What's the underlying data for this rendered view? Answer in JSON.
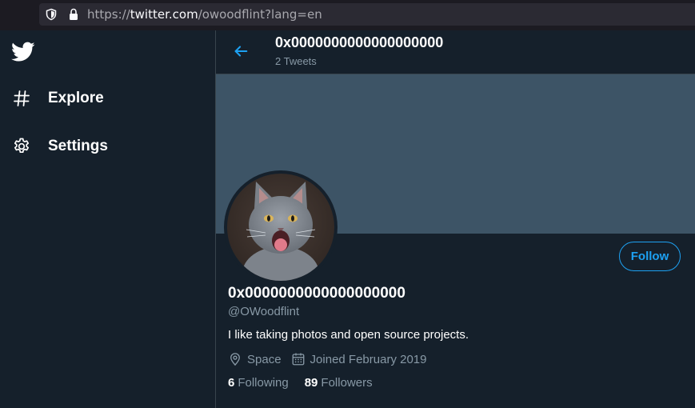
{
  "browser": {
    "url_prefix": "https://",
    "url_host": "twitter.com",
    "url_path": "/owoodflint?lang=en",
    "icons": [
      "shield-icon",
      "lock-icon"
    ]
  },
  "sidebar": {
    "logo": "twitter-bird-icon",
    "items": [
      {
        "label": "Explore",
        "icon": "hashtag-icon"
      },
      {
        "label": "Settings",
        "icon": "gear-icon"
      }
    ]
  },
  "header": {
    "name": "0x0000000000000000000",
    "tweet_count": "2 Tweets",
    "back_icon": "arrow-left-icon"
  },
  "profile": {
    "display_name": "0x0000000000000000000",
    "handle": "@OWoodflint",
    "bio": "I like taking photos and open source projects.",
    "location": "Space",
    "joined": "Joined February 2019",
    "following_count": "6",
    "following_label": "Following",
    "followers_count": "89",
    "followers_label": "Followers",
    "follow_label": "Follow",
    "avatar": "gray kitten photo"
  },
  "colors": {
    "background": "#15202b",
    "banner": "#3d5466",
    "accent": "#1da1f2",
    "secondary_text": "#8899a6",
    "border": "#38444d"
  }
}
